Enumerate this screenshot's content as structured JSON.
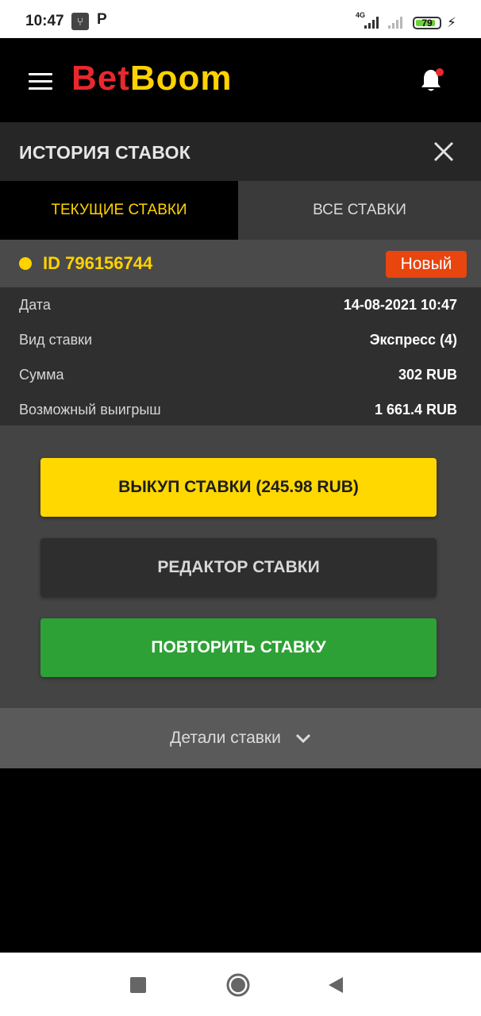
{
  "status_bar": {
    "time": "10:47",
    "usb_icon": "usb-icon",
    "p_icon": "P",
    "network": "4G",
    "battery": "79"
  },
  "header": {
    "logo_part1": "Bet",
    "logo_part2": "Boom",
    "menu_icon": "hamburger-icon",
    "notification_icon": "bell-icon",
    "brand_red": "#e8282e",
    "brand_yellow": "#ffd200"
  },
  "title_bar": {
    "title": "ИСТОРИЯ СТАВОК"
  },
  "tabs": [
    {
      "label": "ТЕКУЩИЕ СТАВКИ",
      "active": true
    },
    {
      "label": "ВСЕ СТАВКИ",
      "active": false
    }
  ],
  "bet": {
    "id": "ID 796156744",
    "status_badge": "Новый",
    "rows": [
      {
        "label": "Дата",
        "value": "14-08-2021 10:47"
      },
      {
        "label": "Вид ставки",
        "value": "Экспресс (4)"
      },
      {
        "label": "Сумма",
        "value": "302 RUB"
      },
      {
        "label": "Возможный выигрыш",
        "value": "1 661.4 RUB"
      }
    ]
  },
  "actions": {
    "cashout": "ВЫКУП СТАВКИ (245.98 RUB)",
    "edit": "РЕДАКТОР СТАВКИ",
    "repeat": "ПОВТОРИТЬ СТАВКУ"
  },
  "details": {
    "label": "Детали ставки"
  }
}
